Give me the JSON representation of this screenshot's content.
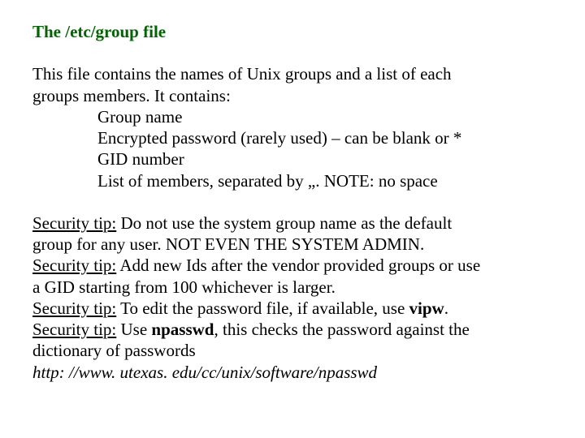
{
  "heading": "The /etc/group file",
  "intro_line1": "This file contains the names of Unix groups and a list of each",
  "intro_line2": "groups members.  It contains:",
  "items": {
    "i1": "Group name",
    "i2": "Encrypted password (rarely used) – can be blank or *",
    "i3": "GID number",
    "i4": "List of members, separated by „.  NOTE: no space"
  },
  "tips": {
    "label": "Security tip:",
    "t1a": " Do not use the system group name as the default",
    "t1b": "group for any user.  NOT EVEN THE SYSTEM ADMIN.",
    "t2a": " Add new Ids after the vendor provided groups or use",
    "t2b": "a GID starting from 100 whichever is larger.",
    "t3a": " To edit the password file, if available, use ",
    "t3b": "vipw",
    "t3c": ".",
    "t4a": " Use ",
    "t4b": "npasswd",
    "t4c": ", this checks the password against the",
    "t4d": "dictionary of passwords"
  },
  "url": "http: //www. utexas. edu/cc/unix/software/npasswd"
}
